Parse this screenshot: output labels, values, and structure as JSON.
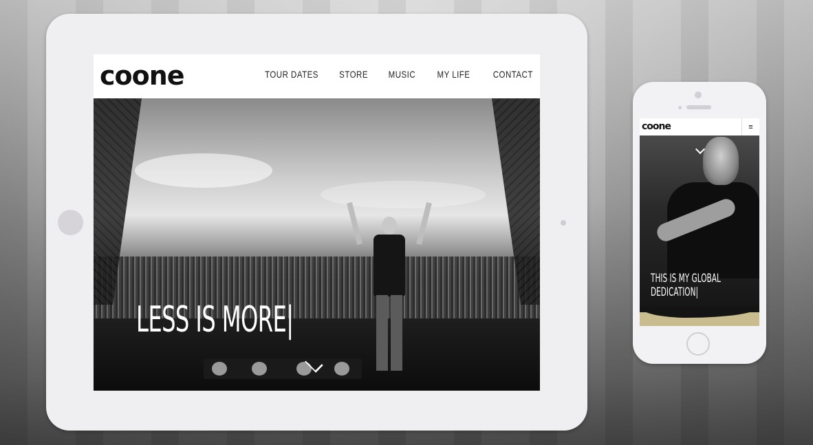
{
  "site": {
    "logo_text": "coone",
    "nav": [
      "TOUR DATES",
      "STORE",
      "MUSIC",
      "MY LIFE",
      "CONTACT"
    ],
    "tablet_headline": "LESS IS MORE|",
    "mobile_headline": "THIS IS MY GLOBAL DEDICATION|",
    "menu_icon": "≡"
  },
  "colors": {
    "accent_band": "#c9bd8f",
    "device_body": "#efeef0",
    "header_bg": "#ffffff"
  },
  "icons": [
    "hamburger-menu-icon",
    "chevron-down-icon"
  ]
}
